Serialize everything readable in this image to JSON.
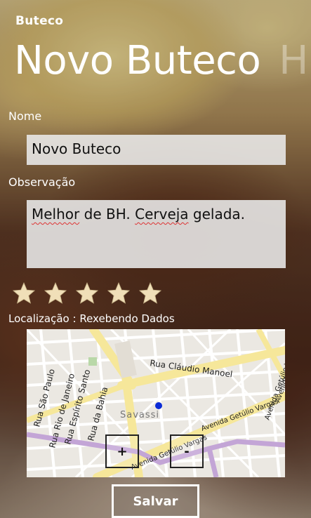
{
  "app": {
    "title": "Buteco"
  },
  "page": {
    "title": "Novo Buteco",
    "next_title_peek": "H"
  },
  "form": {
    "name_label": "Nome",
    "name_value": "Novo Buteco",
    "obs_label": "Observação",
    "obs_words": [
      "Melhor",
      "de",
      "BH.",
      "Cerveja",
      "gelada."
    ],
    "rating": {
      "value": 5,
      "max": 5,
      "star_color": "#f0dfb8"
    },
    "location_label": "Localização : Rexebendo Dados"
  },
  "map": {
    "streets": {
      "claudio_manoel": "Rua Cláudio Manoel",
      "sao_paulo": "Rua São Paulo",
      "rio_de_janeiro": "Rua Rio de Janeiro",
      "espirito_santo": "Rua Espírito Santo",
      "bahia": "Rua da Bahia",
      "getulio_vargas_1": "Avenida Getúlio Vargas",
      "getulio_vargas_2": "Avenida Getúlio Vargas",
      "getulio_vargas_3": "Avenida Getúlio Vargas",
      "getulio_vargas_4": "Avenida Getúlio Vargas"
    },
    "district": "Savassi",
    "zoom_in_label": "+",
    "zoom_out_label": "-",
    "location_dot_color": "#0b2bd6"
  },
  "actions": {
    "save_label": "Salvar"
  }
}
